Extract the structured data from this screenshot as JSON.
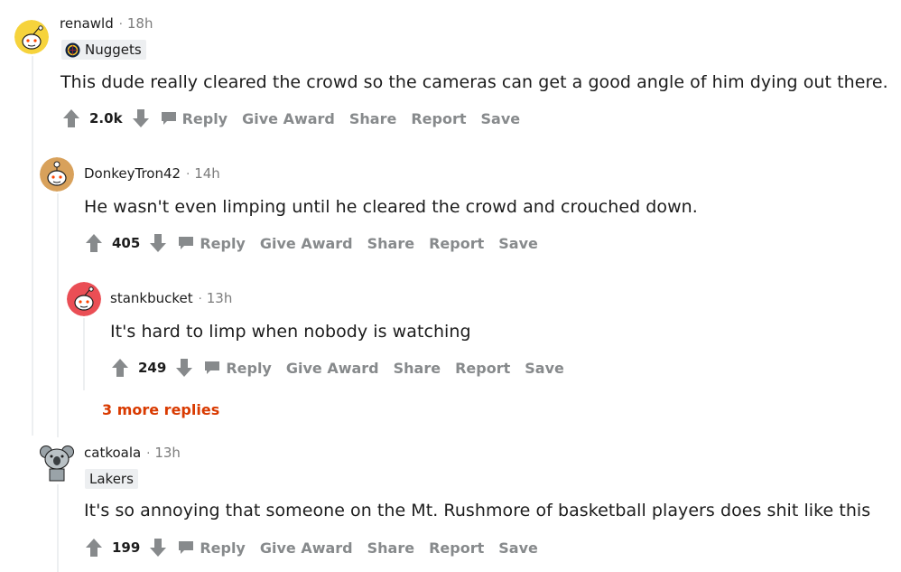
{
  "colors": {
    "text": "#1c1c1c",
    "muted": "#7c7c7c",
    "action": "#878a8c",
    "more_replies": "#d93a00",
    "flair_bg": "#edeff1"
  },
  "actions": {
    "reply": "Reply",
    "give_award": "Give Award",
    "share": "Share",
    "report": "Report",
    "save": "Save"
  },
  "comments": [
    {
      "username": "renawld",
      "separator": "·",
      "time": "18h",
      "flair": "Nuggets",
      "body": "This dude really cleared the crowd so the cameras can get a good angle of him dying out there.",
      "score": "2.0k",
      "avatar_icon": "snoo-yellow-avatar-icon"
    },
    {
      "username": "DonkeyTron42",
      "separator": "·",
      "time": "14h",
      "body": "He wasn't even limping until he cleared the crowd and crouched down.",
      "score": "405",
      "avatar_icon": "snoo-orange-avatar-icon"
    },
    {
      "username": "stankbucket",
      "separator": "·",
      "time": "13h",
      "body": "It's hard to limp when nobody is watching",
      "score": "249",
      "avatar_icon": "snoo-red-avatar-icon"
    },
    {
      "username": "catkoala",
      "separator": "·",
      "time": "13h",
      "flair": "Lakers",
      "body": "It's so annoying that someone on the Mt. Rushmore of basketball players does shit like this",
      "score": "199",
      "avatar_icon": "snoo-koala-avatar-icon"
    }
  ],
  "more_replies": "3 more replies"
}
